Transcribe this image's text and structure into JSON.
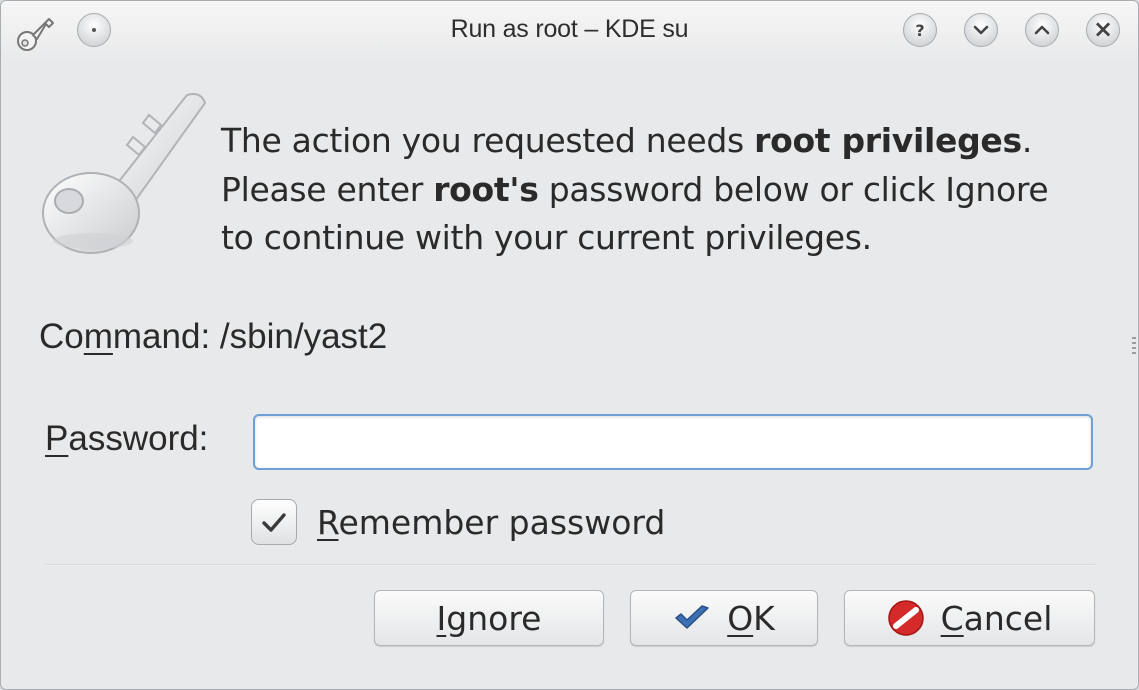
{
  "window": {
    "title": "Run as root – KDE su",
    "titlebar_buttons": [
      {
        "name": "help",
        "glyph": "?"
      },
      {
        "name": "minimize",
        "glyph": "chevron-down"
      },
      {
        "name": "maximize",
        "glyph": "chevron-up"
      },
      {
        "name": "close",
        "glyph": "×"
      }
    ]
  },
  "message": {
    "line1_prefix": "The action you requested needs ",
    "line1_bold": "root privileges",
    "line1_suffix": ".",
    "line2_prefix": "Please enter ",
    "line2_bold": "root's",
    "line2_suffix": " password below or click Ignore",
    "line3": "to continue with your current privileges."
  },
  "command": {
    "label_pre": "Co",
    "label_mnemonic": "m",
    "label_post": "mand:",
    "value": "/sbin/yast2"
  },
  "password": {
    "label_mnemonic": "P",
    "label_post": "assword:",
    "value": "",
    "placeholder": ""
  },
  "remember": {
    "checked": true,
    "label_mnemonic": "R",
    "label_post": "emember password"
  },
  "buttons": {
    "ignore": {
      "mnemonic": "I",
      "rest": "gnore"
    },
    "ok": {
      "mnemonic": "O",
      "rest": "K",
      "icon": "checkmark-icon"
    },
    "cancel": {
      "mnemonic": "C",
      "rest": "ancel",
      "icon": "cancel-icon"
    }
  },
  "colors": {
    "focus_border": "#6e9fd6",
    "ok_check": "#3d6fb3",
    "cancel_red": "#d42a2a"
  }
}
